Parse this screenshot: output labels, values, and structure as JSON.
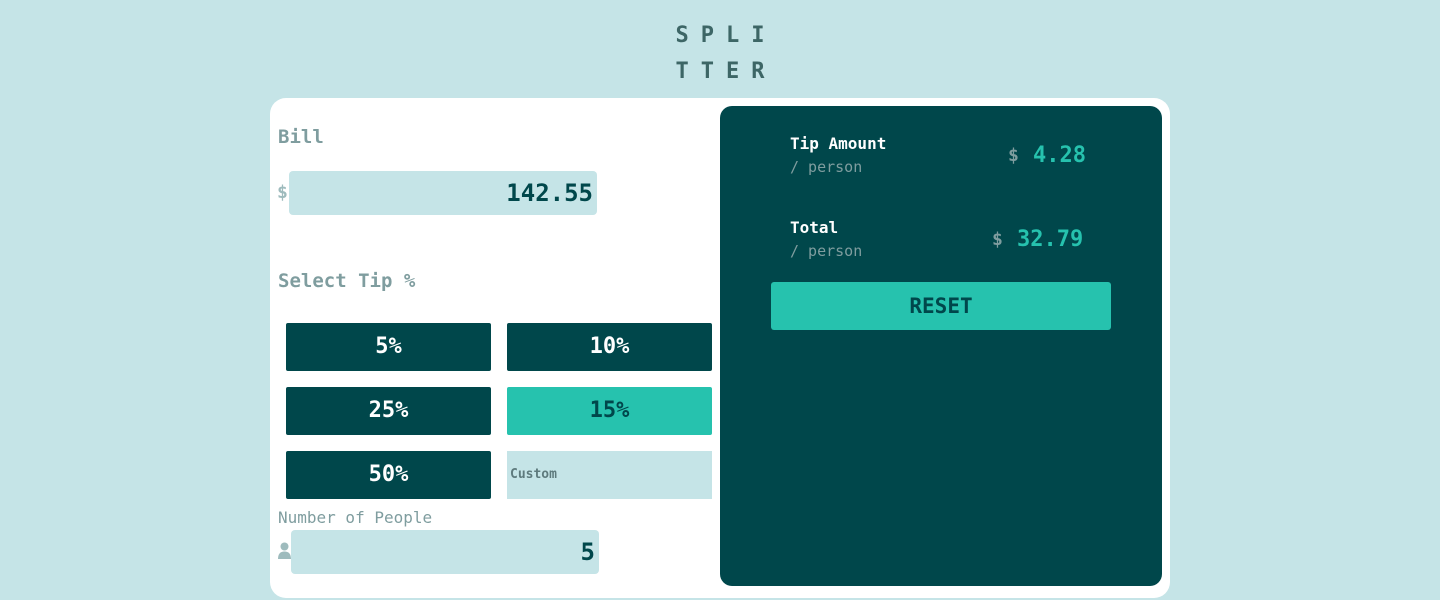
{
  "logo": {
    "line1": "SPLI",
    "line2": "TTER"
  },
  "bill": {
    "label": "Bill",
    "currency_symbol": "$",
    "value": "142.55"
  },
  "tip": {
    "label": "Select Tip %",
    "options": [
      "5%",
      "10%",
      "25%",
      "15%",
      "50%"
    ],
    "selected": "15%",
    "custom_placeholder": "Custom"
  },
  "people": {
    "label": "Number of People",
    "value": "5",
    "icon": "person-icon"
  },
  "results": {
    "tip_amount": {
      "title": "Tip Amount",
      "sub": "/ person",
      "currency": "$",
      "value": "4.28"
    },
    "total": {
      "title": "Total",
      "sub": "/ person",
      "currency": "$",
      "value": "32.79"
    },
    "reset_label": "RESET"
  },
  "colors": {
    "background": "#c5e4e7",
    "dark_teal": "#00474b",
    "accent": "#26c2ae",
    "muted": "#7f9d9f"
  }
}
